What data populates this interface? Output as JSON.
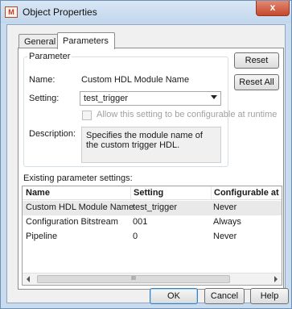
{
  "window": {
    "title": "Object Properties",
    "close_glyph": "x",
    "icon": "app-icon",
    "icon_label": "M"
  },
  "tabs": [
    {
      "label": "General"
    },
    {
      "label": "Parameters"
    }
  ],
  "parameter_group": {
    "legend": "Parameter",
    "name_label": "Name:",
    "name_value": "Custom HDL Module Name",
    "setting_label": "Setting:",
    "setting_value": "test_trigger",
    "allow_runtime_label": "Allow this setting to be configurable at runtime",
    "description_label": "Description:",
    "description_value": "Specifies the module name of the custom trigger HDL."
  },
  "buttons": {
    "reset": "Reset",
    "reset_all": "Reset All",
    "ok": "OK",
    "cancel": "Cancel",
    "help": "Help"
  },
  "existing": {
    "label": "Existing parameter settings:",
    "columns": [
      "Name",
      "Setting",
      "Configurable at Runti"
    ],
    "rows": [
      {
        "name": "Custom HDL Module Name",
        "setting": "test_trigger",
        "configurable": "Never"
      },
      {
        "name": "Configuration Bitstream",
        "setting": "001",
        "configurable": "Always"
      },
      {
        "name": "Pipeline",
        "setting": "0",
        "configurable": "Never"
      }
    ],
    "scroll_thumb_label": "III"
  }
}
